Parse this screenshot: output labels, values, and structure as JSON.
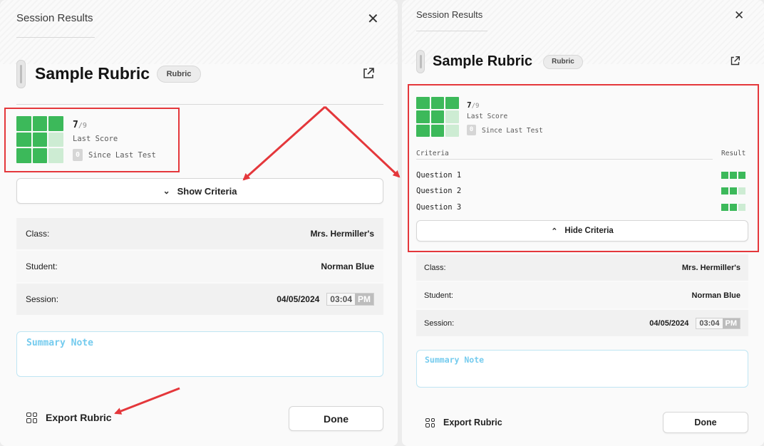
{
  "header": {
    "title": "Session Results"
  },
  "rubric": {
    "title": "Sample Rubric",
    "tag": "Rubric"
  },
  "score": {
    "value": "7",
    "max": "/9",
    "label": "Last Score",
    "delta": "0",
    "delta_label": "Since Last Test",
    "fill": [
      1,
      1,
      1,
      1,
      1,
      0,
      1,
      1,
      0
    ]
  },
  "buttons": {
    "show_criteria": "Show Criteria",
    "hide_criteria": "Hide Criteria",
    "export": "Export Rubric",
    "done": "Done"
  },
  "info": {
    "class_label": "Class:",
    "class_value": "Mrs. Hermiller's",
    "student_label": "Student:",
    "student_value": "Norman Blue",
    "session_label": "Session:",
    "session_date": "04/05/2024",
    "session_time": "03:04",
    "session_ampm": "PM"
  },
  "note": {
    "placeholder": "Summary Note"
  },
  "criteria": {
    "header_left": "Criteria",
    "header_right": "Result",
    "items": [
      {
        "label": "Question 1",
        "result": [
          1,
          1,
          1
        ]
      },
      {
        "label": "Question 2",
        "result": [
          1,
          1,
          0
        ]
      },
      {
        "label": "Question 3",
        "result": [
          1,
          1,
          0
        ]
      }
    ]
  },
  "colors": {
    "accent_green": "#3cb95a",
    "light_green": "#cdecd3",
    "highlight": "#e4373b",
    "note_text": "#74cbee"
  }
}
